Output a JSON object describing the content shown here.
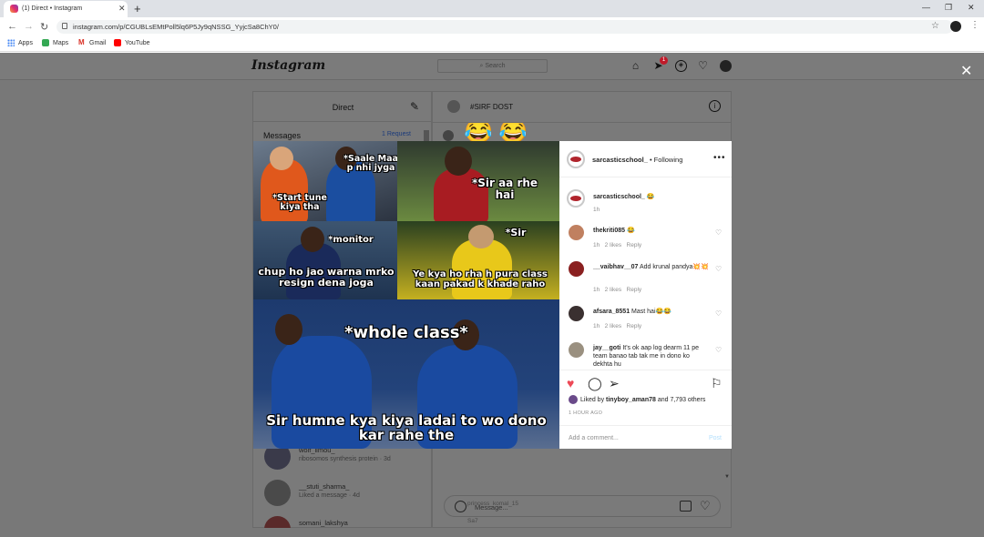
{
  "browser": {
    "tab_title": "(1) Direct • Instagram",
    "url": "instagram.com/p/CGUBLsEMtPoll5lq6P5Jy9qNSSG_YyjcSa8ChY0/",
    "bookmarks": [
      "Apps",
      "Maps",
      "Gmail",
      "YouTube"
    ]
  },
  "ig": {
    "logo": "Instagram",
    "search_placeholder": "Search",
    "notification_count": "1"
  },
  "direct": {
    "title": "Direct",
    "messages_label": "Messages",
    "requests": "1 Request",
    "conversations": [
      {
        "name": "wolf_limou_",
        "sub": "ribosomos synthesis protein · 3d"
      },
      {
        "name": "__stuti_sharma_",
        "sub": "Liked a message · 4d"
      },
      {
        "name": "somani_lakshya",
        "sub": ""
      }
    ]
  },
  "chat": {
    "name": "#SIRF DOST",
    "ghost_user": "princess_komal_15",
    "ghost_msg": "Sa7",
    "message_placeholder": "Message..."
  },
  "post": {
    "username": "sarcasticschool_",
    "following": "• Following",
    "caption_emoji": "😂",
    "caption_time": "1h",
    "meme_captions": {
      "c1": "*Saale Maa p nhi jyga",
      "c2": "*Start tune kiya tha",
      "c3": "*Sir aa rhe hai",
      "c4": "*monitor",
      "c5": "chup ho jao warna mrko resign dena joga",
      "c6": "*Sir",
      "c7": "Ye kya ho rha h pura class kaan pakad k khade raho",
      "c8": "*whole class*",
      "c9": "Sir humne kya kiya ladai to wo dono kar rahe the"
    },
    "comments": [
      {
        "user": "thekriti085",
        "text": "😂",
        "time": "1h",
        "likes": "2 likes",
        "reply": "Reply"
      },
      {
        "user": "__vaibhav__07",
        "text": "Add krunal pandya💥💥",
        "time": "1h",
        "likes": "2 likes",
        "reply": "Reply"
      },
      {
        "user": "afsara_8551",
        "text": "Mast hai😂😂",
        "time": "1h",
        "likes": "2 likes",
        "reply": "Reply"
      },
      {
        "user": "jay__goti",
        "text": "It's ok aap log dearm 11 pe team banao tab tak me in dono ko dekhta hu",
        "time": "",
        "likes": "",
        "reply": ""
      }
    ],
    "liked_by_prefix": "Liked by",
    "liked_by_user": "tinyboy_aman78",
    "liked_by_suffix": "and 7,793 others",
    "ago": "1 HOUR AGO",
    "add_comment_placeholder": "Add a comment...",
    "post_button": "Post"
  },
  "colors": {
    "heart_red": "#ed4956",
    "link_blue": "#0095f6",
    "overlay_gray": "#787878"
  }
}
